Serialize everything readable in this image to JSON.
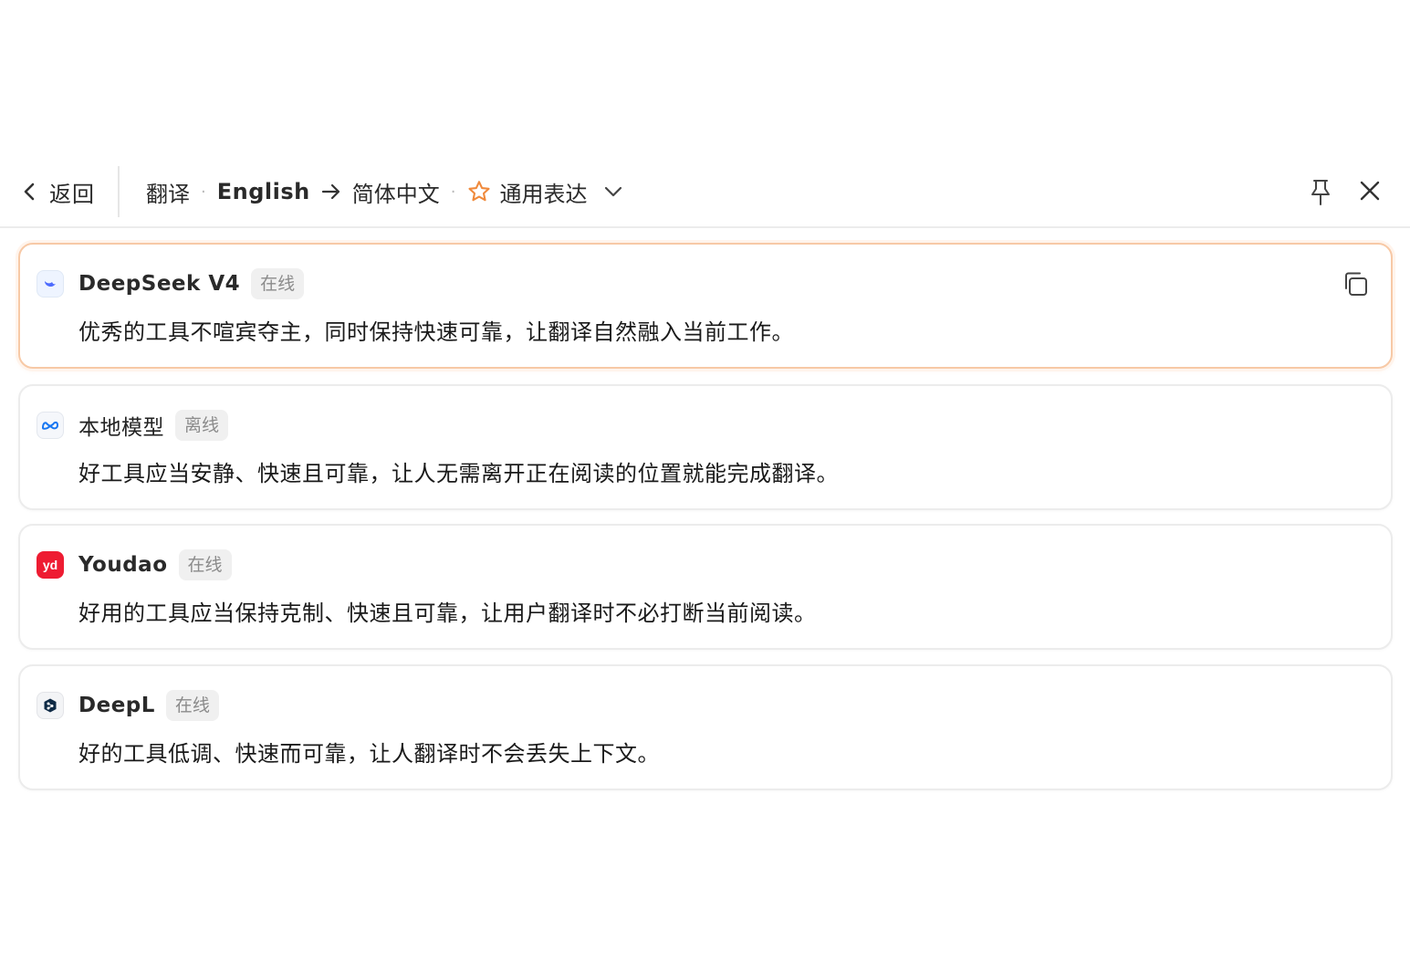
{
  "header": {
    "back_label": "返回",
    "mode": "翻译",
    "source_lang": "English",
    "target_lang": "简体中文",
    "style_label": "通用表达",
    "accent_color": "#f08a3c"
  },
  "results": [
    {
      "engine": "DeepSeek V4",
      "status": "在线",
      "icon": "deepseek-logo",
      "text": "优秀的工具不喧宾夺主，同时保持快速可靠，让翻译自然融入当前工作。",
      "active": true
    },
    {
      "engine": "本地模型",
      "status": "离线",
      "icon": "meta-logo",
      "text": "好工具应当安静、快速且可靠，让人无需离开正在阅读的位置就能完成翻译。",
      "active": false
    },
    {
      "engine": "Youdao",
      "status": "在线",
      "icon": "youdao-logo",
      "text": "好用的工具应当保持克制、快速且可靠，让用户翻译时不必打断当前阅读。",
      "active": false
    },
    {
      "engine": "DeepL",
      "status": "在线",
      "icon": "deepl-logo",
      "text": "好的工具低调、快速而可靠，让人翻译时不会丢失上下文。",
      "active": false
    }
  ]
}
